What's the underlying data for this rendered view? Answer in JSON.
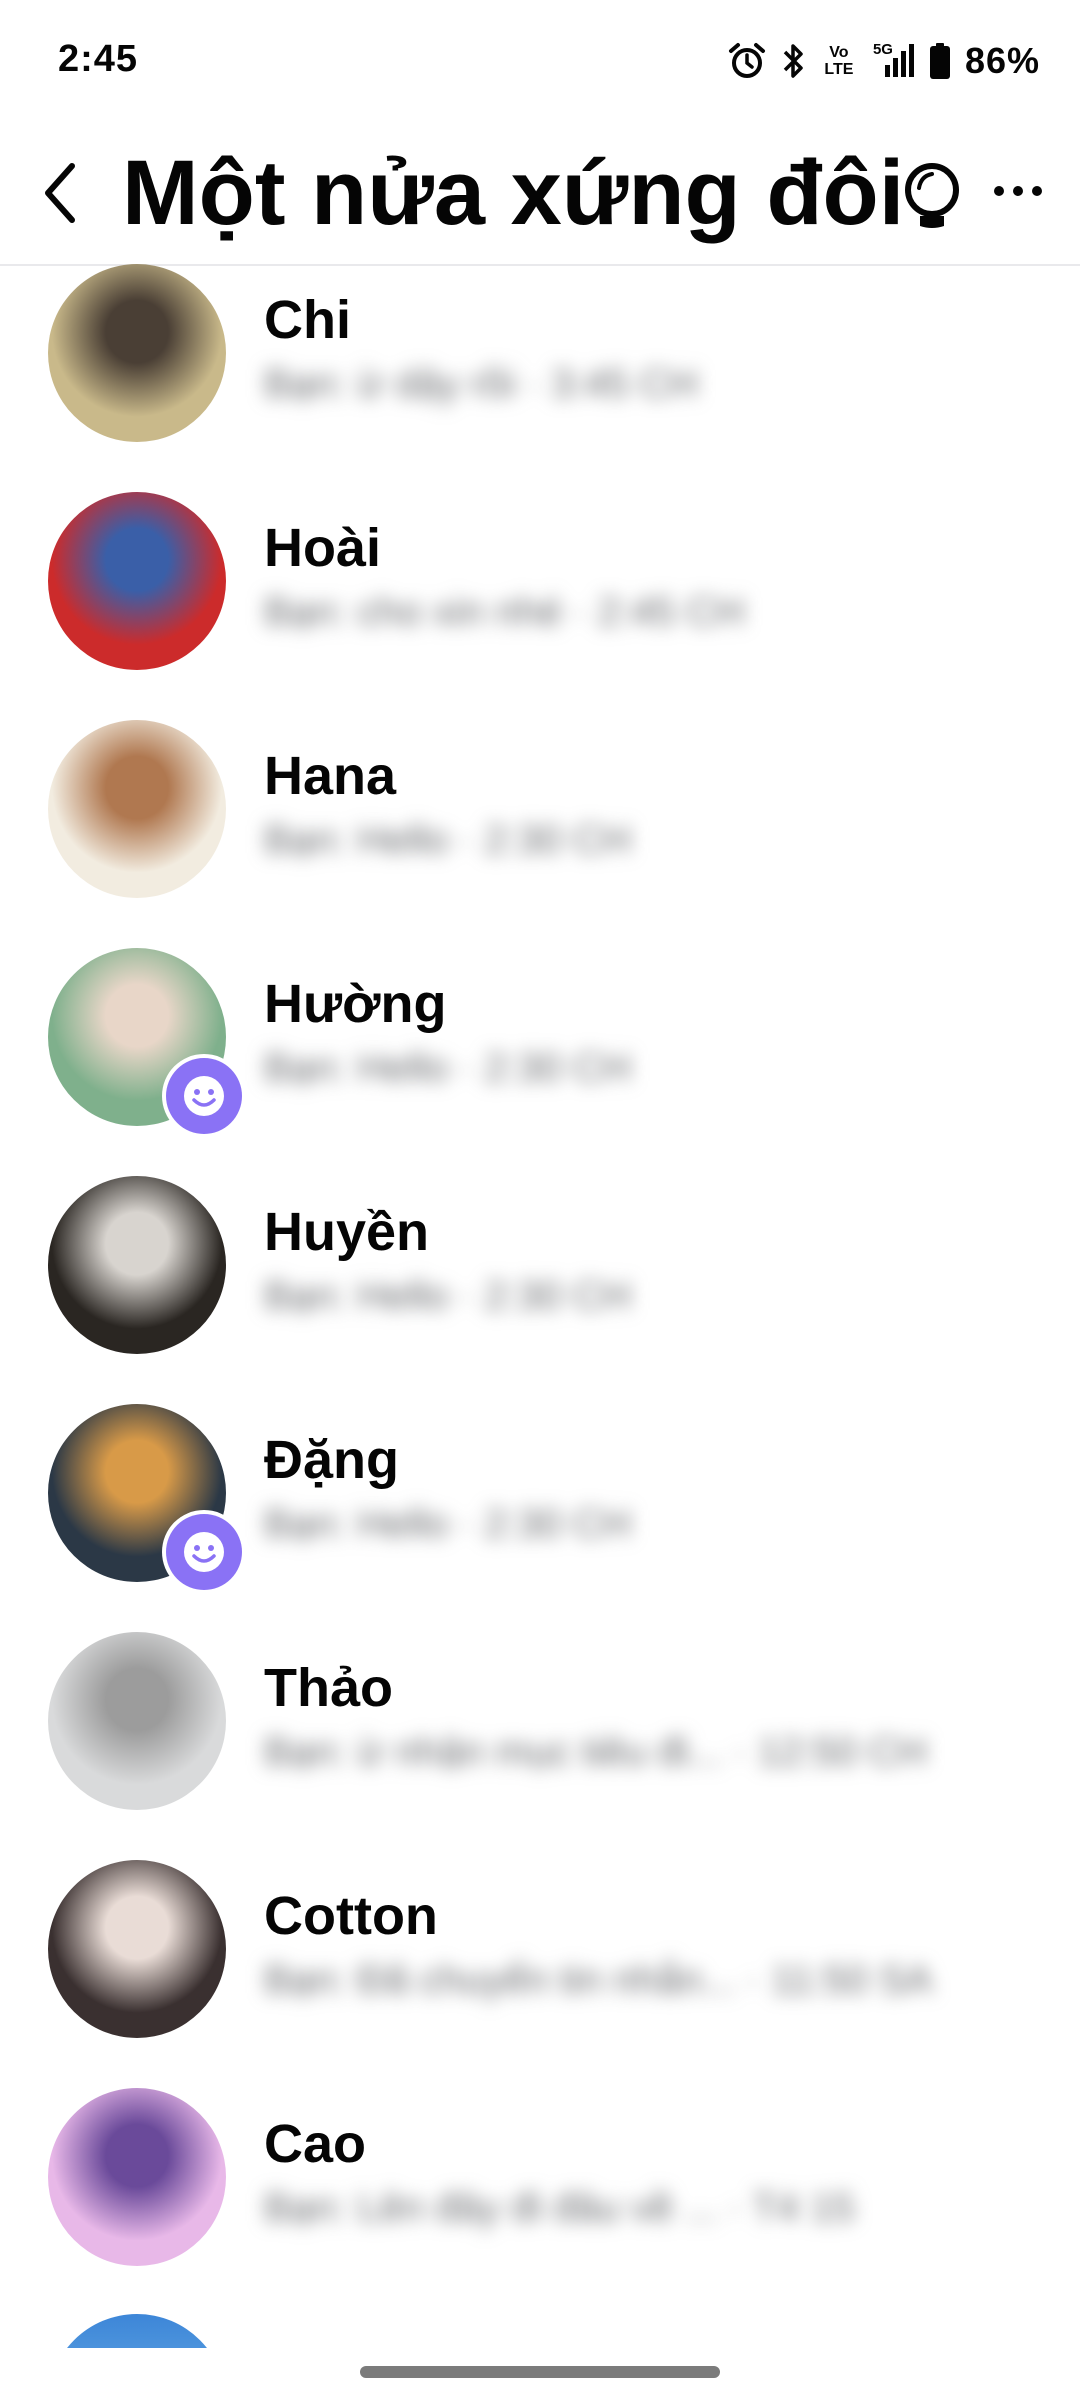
{
  "status_bar": {
    "time": "2:45",
    "volte_line1": "Vo",
    "volte_line2": "LTE",
    "network": "5G",
    "battery_percent": "86%",
    "icons": [
      "alarm-icon",
      "bluetooth-icon",
      "volte-icon",
      "signal-icon",
      "battery-icon"
    ]
  },
  "header": {
    "title": "Một nửa xứng đôi",
    "back_icon": "chevron-left-icon",
    "idea_icon": "lightbulb-icon",
    "more_icon": "more-horizontal-icon"
  },
  "members": [
    {
      "name": "Chi",
      "subtitle": "Bạn: ừ dậy rồi · 3:45 CH",
      "has_badge": false,
      "avatar_colors": [
        "#c9b98a",
        "#4a3f35"
      ]
    },
    {
      "name": "Hoài",
      "subtitle": "Bạn: cho xin nhé · 2:45 CH",
      "has_badge": false,
      "avatar_colors": [
        "#cc2b2b",
        "#3a5fa8"
      ]
    },
    {
      "name": "Hana",
      "subtitle": "Bạn: Hello · 2:30 CH",
      "has_badge": false,
      "avatar_colors": [
        "#f2ece0",
        "#b07850"
      ]
    },
    {
      "name": "Hường",
      "subtitle": "Bạn: Hello · 2:30 CH",
      "has_badge": true,
      "avatar_colors": [
        "#7fb08c",
        "#e8d6c8"
      ]
    },
    {
      "name": "Huyền",
      "subtitle": "Bạn: Hello · 2:30 CH",
      "has_badge": false,
      "avatar_colors": [
        "#2a2622",
        "#d8d4cf"
      ]
    },
    {
      "name": "Đặng",
      "subtitle": "Bạn: Hello · 2:30 CH",
      "has_badge": true,
      "avatar_colors": [
        "#2b3846",
        "#d89a48"
      ]
    },
    {
      "name": "Thảo",
      "subtitle": "Bạn: ừ nhận mục tiêu đi... · 12:50 CH",
      "has_badge": false,
      "avatar_colors": [
        "#d9dadb",
        "#9c9c9c"
      ]
    },
    {
      "name": "Cotton",
      "subtitle": "Bạn: Đã chuyển tin nhắn... · 11:50 SA",
      "has_badge": false,
      "avatar_colors": [
        "#3a3030",
        "#e9dcd6"
      ]
    },
    {
      "name": "Cao",
      "subtitle": "Bạn: Lên đây đi đâu về ... · T4 15",
      "has_badge": false,
      "avatar_colors": [
        "#e8b8e8",
        "#6a4a9a"
      ]
    }
  ],
  "badge_icon": "smiley-icon",
  "badge_color": "#8a72f5"
}
